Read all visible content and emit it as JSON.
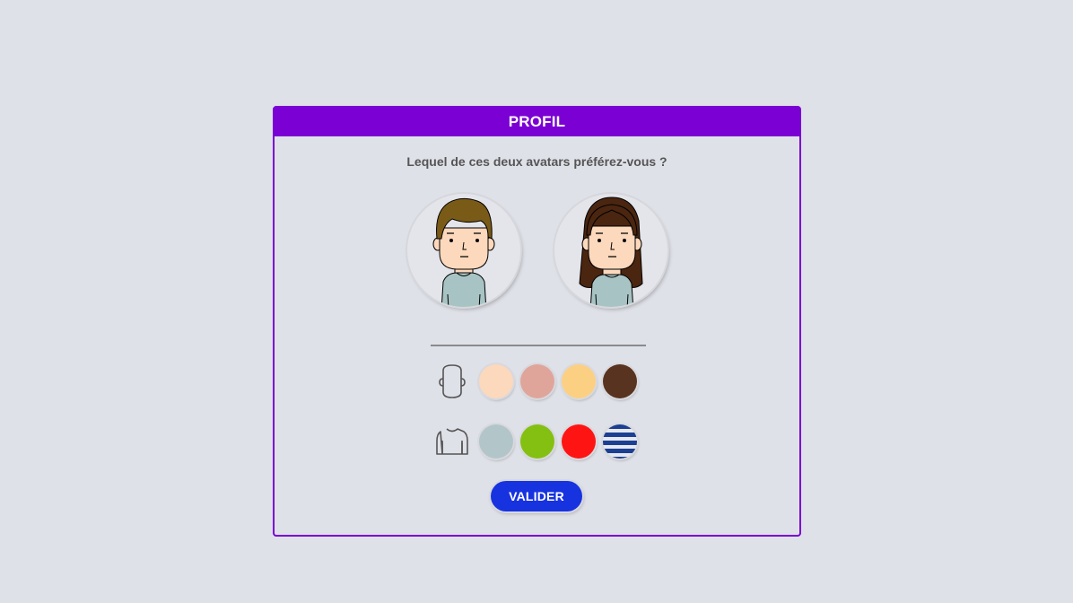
{
  "header": {
    "title": "PROFIL"
  },
  "question": "Lequel de ces deux avatars préférez-vous ?",
  "avatars": [
    {
      "name": "boy",
      "hair_color": "#7a5a17"
    },
    {
      "name": "girl",
      "hair_color": "#4a2510"
    }
  ],
  "skin_options": {
    "icon": "head-outline-icon",
    "colors": [
      "#fcd8bc",
      "#e0a59a",
      "#fcd083",
      "#583320"
    ]
  },
  "shirt_options": {
    "icon": "sweater-outline-icon",
    "colors": [
      "#b2c6ca",
      "#84c011",
      "#ff1414",
      "striped-blue-white"
    ]
  },
  "colors": {
    "accent": "#7a00d4",
    "button": "#1733e0",
    "background": "#dfe1e8"
  },
  "submit_label": "VALIDER"
}
